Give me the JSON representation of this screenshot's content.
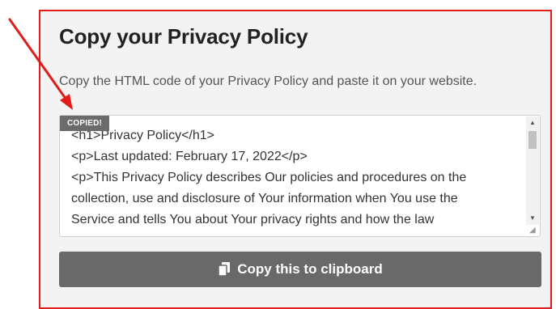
{
  "panel": {
    "title": "Copy your Privacy Policy",
    "description": "Copy the HTML code of your Privacy Policy and paste it on your website."
  },
  "code_box": {
    "lines": [
      "<h1>Privacy Policy</h1>",
      "<p>Last updated: February 17, 2022</p>",
      "<p>This Privacy Policy describes Our policies and procedures on the",
      "collection, use and disclosure of Your information when You use the",
      "Service and tells You about Your privacy rights and how the law"
    ]
  },
  "badge": {
    "label": "COPIED!"
  },
  "copy_button": {
    "label": "Copy this to clipboard",
    "icon": "clipboard-icon"
  },
  "annotation": {
    "arrow_color": "#e21b1b"
  }
}
